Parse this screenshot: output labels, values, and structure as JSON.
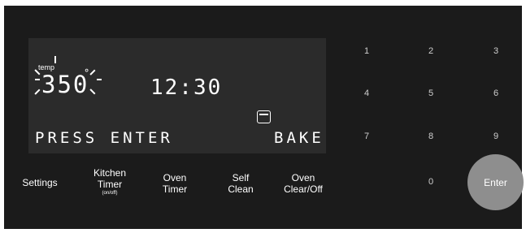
{
  "display": {
    "temp_label": "temp",
    "temperature": "350",
    "degree_symbol": "°",
    "clock": "12:30",
    "message": "PRESS ENTER",
    "mode": "BAKE"
  },
  "controls": {
    "settings": "Settings",
    "kitchen_timer": "Kitchen\nTimer",
    "kitchen_timer_sub": "(on/off)",
    "oven_timer": "Oven\nTimer",
    "self_clean": "Self\nClean",
    "oven_clear": "Oven\nClear/Off"
  },
  "keypad": [
    "1",
    "2",
    "3",
    "4",
    "5",
    "6",
    "7",
    "8",
    "9",
    "0"
  ],
  "enter_label": "Enter",
  "colors": {
    "panel": "#1b1b1b",
    "display": "#2b2b2b",
    "enter_button": "#8e8e8e"
  }
}
